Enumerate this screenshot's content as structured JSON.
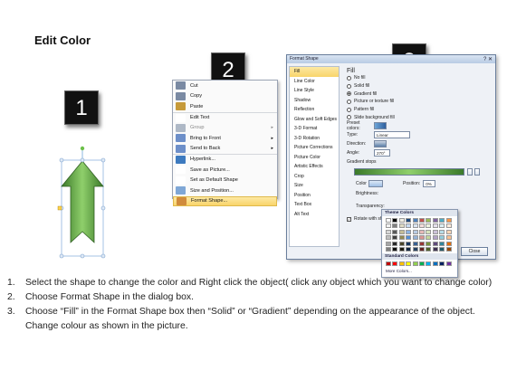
{
  "slide": {
    "title": "Edit Color"
  },
  "steps": [
    "1",
    "2",
    "3"
  ],
  "context_menu": {
    "items": [
      {
        "label": "Cut",
        "icon": "scissors-icon",
        "color": "#7a8aa3"
      },
      {
        "label": "Copy",
        "icon": "copy-icon",
        "color": "#7a8aa3"
      },
      {
        "label": "Paste",
        "icon": "paste-icon",
        "color": "#c69a3a"
      },
      {
        "label": "Edit Text",
        "icon": "edit-text-icon",
        "color": "#ffffff"
      },
      {
        "label": "Group",
        "icon": "group-icon",
        "color": "#aeb8c6",
        "dim": true,
        "arrow": "▸"
      },
      {
        "label": "Bring to Front",
        "icon": "bring-front-icon",
        "color": "#6d8fc9",
        "arrow": "▸"
      },
      {
        "label": "Send to Back",
        "icon": "send-back-icon",
        "color": "#6d8fc9",
        "arrow": "▸"
      },
      {
        "label": "Hyperlink...",
        "icon": "globe-icon",
        "color": "#3d7abf"
      },
      {
        "label": "Save as Picture...",
        "icon": "blank-icon",
        "color": "#ffffff"
      },
      {
        "label": "Set as Default Shape",
        "icon": "blank-icon",
        "color": "#ffffff"
      },
      {
        "label": "Size and Position...",
        "icon": "size-icon",
        "color": "#7fa7d6"
      },
      {
        "label": "Format Shape...",
        "icon": "format-shape-icon",
        "color": "#d08b3c",
        "highlight": true
      }
    ]
  },
  "dialog": {
    "title": "Format Shape",
    "close_glyph": "? ✕",
    "left_items": [
      "Fill",
      "Line Color",
      "Line Style",
      "Shadow",
      "Reflection",
      "Glow and Soft Edges",
      "3-D Format",
      "3-D Rotation",
      "Picture Corrections",
      "Picture Color",
      "Artistic Effects",
      "Crop",
      "Size",
      "Position",
      "Text Box",
      "Alt Text"
    ],
    "heading": "Fill",
    "fill_options": [
      {
        "label": "No fill",
        "on": false
      },
      {
        "label": "Solid fill",
        "on": false
      },
      {
        "label": "Gradient fill",
        "on": true
      },
      {
        "label": "Picture or texture fill",
        "on": false
      },
      {
        "label": "Pattern fill",
        "on": false
      },
      {
        "label": "Slide background fill",
        "on": false
      }
    ],
    "preset_label": "Preset colors:",
    "type_label": "Type:",
    "type_value": "Linear",
    "direction_label": "Direction:",
    "angle_label": "Angle:",
    "angle_value": "270°",
    "gradient_stops_label": "Gradient stops",
    "color_label": "Color",
    "position_label": "Position:",
    "position_value": "0%",
    "brightness_label": "Brightness:",
    "transparency_label": "Transparency:",
    "rotate_label": "Rotate with shape",
    "close_label": "Close"
  },
  "palette": {
    "theme_heading": "Theme Colors",
    "standard_heading": "Standard Colors",
    "more_label": "More Colors...",
    "theme_top": [
      "#ffffff",
      "#000000",
      "#eeece1",
      "#1f497d",
      "#4f81bd",
      "#c0504d",
      "#9bbb59",
      "#8064a2",
      "#4bacc6",
      "#f79646"
    ],
    "theme_shades": [
      [
        "#f2f2f2",
        "#7f7f7f",
        "#ddd9c3",
        "#c6d9f0",
        "#dbe5f1",
        "#f2dcdb",
        "#ebf1dd",
        "#e5e0ec",
        "#dbeef3",
        "#fdeada"
      ],
      [
        "#d8d8d8",
        "#595959",
        "#c4bd97",
        "#8db3e2",
        "#b8cce4",
        "#e5b9b7",
        "#d7e3bc",
        "#ccc1d9",
        "#b7dde8",
        "#fbd5b5"
      ],
      [
        "#bfbfbf",
        "#3f3f3f",
        "#938953",
        "#548dd4",
        "#95b3d7",
        "#d99694",
        "#c3d69b",
        "#b2a2c7",
        "#92cddc",
        "#fac08f"
      ],
      [
        "#a5a5a5",
        "#262626",
        "#494429",
        "#17365d",
        "#366092",
        "#953734",
        "#76923c",
        "#5f497a",
        "#31859b",
        "#e36c09"
      ],
      [
        "#7f7f7f",
        "#0c0c0c",
        "#1d1b10",
        "#0f243e",
        "#244061",
        "#632423",
        "#4f6128",
        "#3f3151",
        "#205867",
        "#974806"
      ]
    ],
    "standard": [
      "#c00000",
      "#ff0000",
      "#ffc000",
      "#ffff00",
      "#92d050",
      "#00b050",
      "#00b0f0",
      "#0070c0",
      "#002060",
      "#7030a0"
    ]
  },
  "instructions": [
    {
      "num": "1.",
      "text": "Select the shape to change the color and Right click the object( click any object which you want to change color)"
    },
    {
      "num": "2.",
      "text": "Choose Format Shape in the dialog box."
    },
    {
      "num": "3.",
      "text": "Choose “Fill” in the Format Shape box then “Solid” or “Gradient” depending on the appearance of the object. Change colour as shown in the picture."
    }
  ]
}
